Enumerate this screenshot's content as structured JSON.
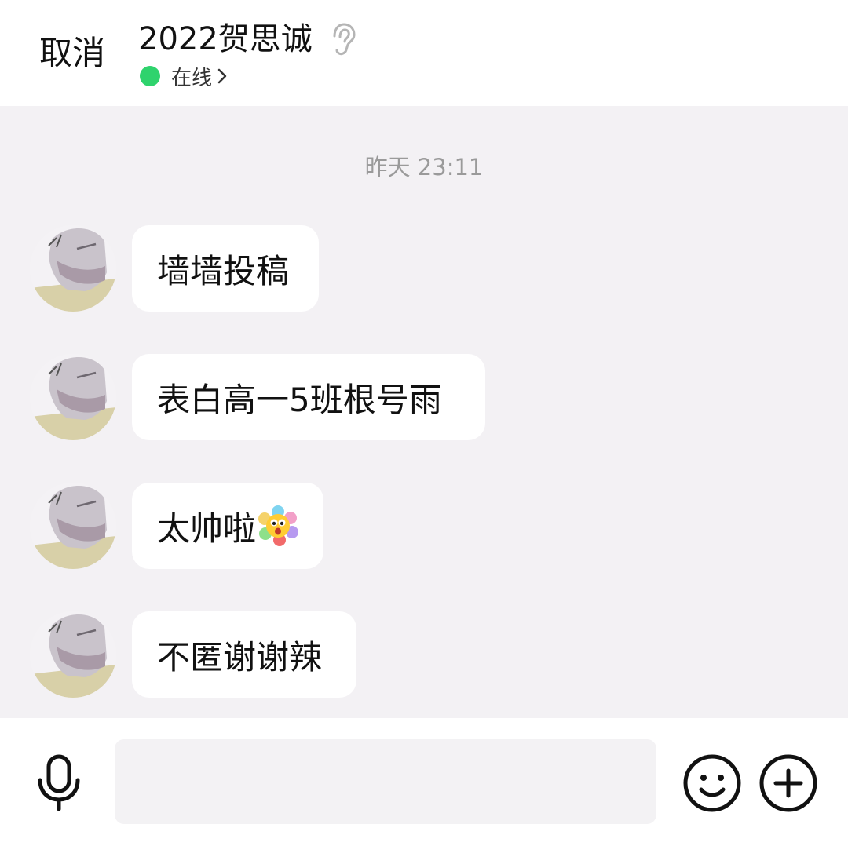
{
  "header": {
    "cancel_label": "取消",
    "title": "2022贺思诚",
    "status_text": "在线",
    "status_color": "#2fd36d",
    "icons": [
      "ear-icon",
      "chevron-right-icon"
    ]
  },
  "chat": {
    "timestamp": "昨天 23:11",
    "messages": [
      {
        "text": "墙墙投稿"
      },
      {
        "text": "表白高一5班根号雨"
      },
      {
        "text": "太帅啦",
        "emoji": "sun-flower-emoji-icon"
      },
      {
        "text": "不匿谢谢辣"
      }
    ]
  },
  "input_bar": {
    "icons": [
      "mic-icon",
      "smile-icon",
      "plus-icon"
    ],
    "input_value": ""
  },
  "colors": {
    "background": "#f3f1f4",
    "bubble": "#ffffff",
    "timestamp": "#9a9a9a"
  }
}
